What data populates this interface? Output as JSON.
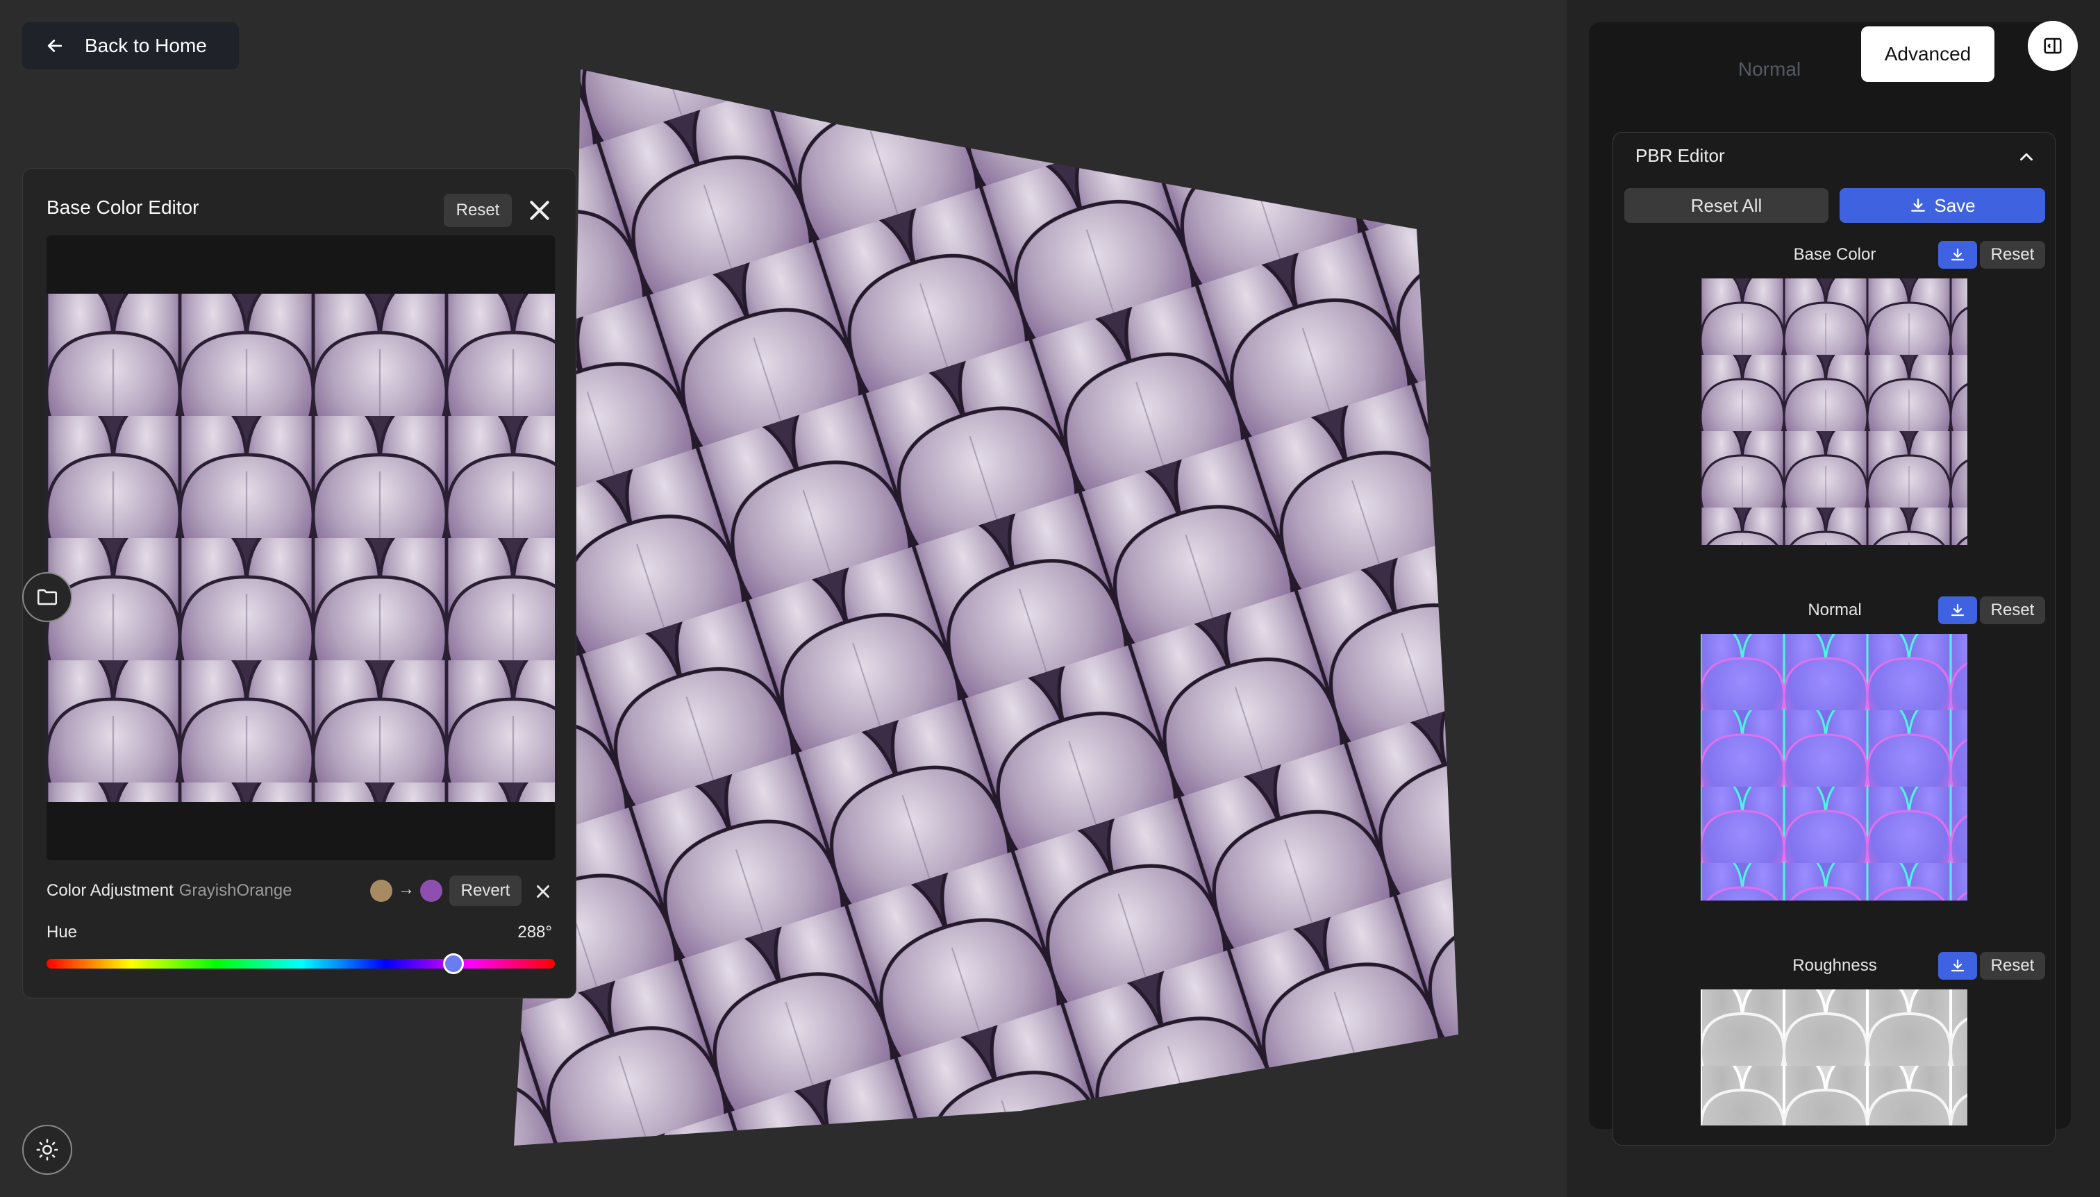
{
  "header": {
    "back_label": "Back to Home"
  },
  "editor": {
    "title": "Base Color Editor",
    "reset_label": "Reset",
    "color_adjustment_label": "Color Adjustment",
    "color_adjustment_name": "GrayishOrange",
    "from_color": "#a78b62",
    "to_color": "#8f4fb0",
    "arrow": "→",
    "revert_label": "Revert",
    "hue_label": "Hue",
    "hue_value": "288°",
    "hue_fraction": 0.8
  },
  "panel": {
    "tabs": [
      {
        "label": "Normal",
        "active": false
      },
      {
        "label": "Advanced",
        "active": true
      }
    ],
    "pbr_title": "PBR Editor",
    "reset_all_label": "Reset All",
    "save_label": "Save",
    "maps": [
      {
        "label": "Base Color",
        "reset_label": "Reset"
      },
      {
        "label": "Normal",
        "reset_label": "Reset"
      },
      {
        "label": "Roughness",
        "reset_label": "Reset"
      }
    ]
  },
  "colors": {
    "accent": "#3f63e0",
    "scale_purple": "#8a6aa0",
    "scale_highlight": "#d8d0de",
    "normal_map": "#8a7ff0",
    "roughness": "#c8c8c8"
  },
  "icons": [
    "arrow-left-icon",
    "close-icon",
    "folder-icon",
    "sun-icon",
    "panel-toggle-icon",
    "chevron-up-icon",
    "download-icon"
  ]
}
